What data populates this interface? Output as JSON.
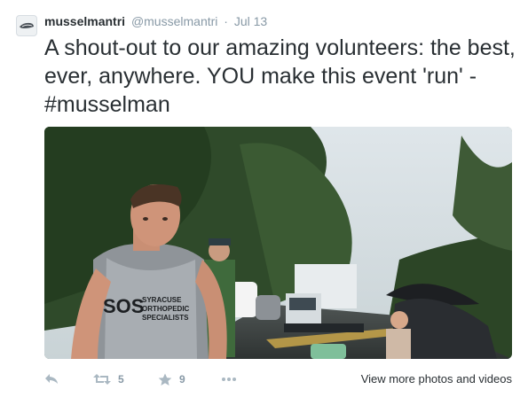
{
  "tweet": {
    "display_name": "musselmantri",
    "handle": "@musselmantri",
    "separator": "·",
    "date": "Jul 13",
    "text": "A shout-out to our amazing volunteers: the best, ever, anywhere. YOU make this event 'run' - #musselman"
  },
  "photo": {
    "jersey_lines": [
      "SYRACUSE",
      "ORTHOPEDIC",
      "SPECIALISTS"
    ],
    "jersey_logo": "SOS"
  },
  "actions": {
    "reply_icon": "reply-icon",
    "retweet_icon": "retweet-icon",
    "retweet_count": "5",
    "favorite_icon": "star-icon",
    "favorite_count": "9",
    "more_icon": "more-icon",
    "view_more_label": "View more photos and videos"
  },
  "colors": {
    "text": "#292f33",
    "muted": "#8899a6",
    "icon": "#aab8c2"
  }
}
